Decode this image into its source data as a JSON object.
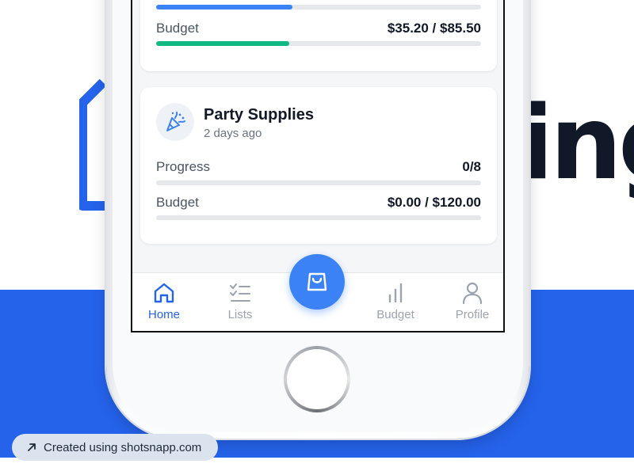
{
  "background": {
    "word_fragment": "ing",
    "band_color": "#2563eb"
  },
  "cards": [
    {
      "budget_label": "Budget",
      "budget_value": "$35.20 / $85.50",
      "progress_fraction": 0.42,
      "budget_fraction": 0.41,
      "progress_color": "#3b82f6",
      "budget_color": "#10b981"
    },
    {
      "icon": "party-popper-icon",
      "title": "Party Supplies",
      "subtitle": "2 days ago",
      "progress_label": "Progress",
      "progress_value": "0/8",
      "budget_label": "Budget",
      "budget_value": "$0.00 / $120.00",
      "progress_fraction": 0,
      "budget_fraction": 0
    }
  ],
  "tabbar": {
    "tabs": [
      {
        "label": "Home",
        "icon": "home-icon",
        "active": true
      },
      {
        "label": "Lists",
        "icon": "checklist-icon",
        "active": false
      },
      {
        "label": "Budget",
        "icon": "bar-chart-icon",
        "active": false
      },
      {
        "label": "Profile",
        "icon": "user-icon",
        "active": false
      }
    ],
    "fab_icon": "shopping-bag-icon",
    "active_color": "#2563eb",
    "inactive_color": "#9ca3af"
  },
  "credit": {
    "icon": "arrow-up-right-icon",
    "text": "Created using shotsnapp.com"
  }
}
